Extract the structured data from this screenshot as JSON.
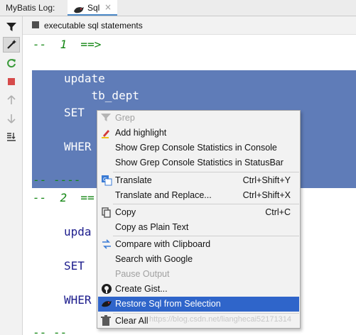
{
  "tool_window": {
    "title": "MyBatis Log:",
    "tab_label": "Sql",
    "tab_close": "×"
  },
  "console_header": {
    "label": "executable sql statements"
  },
  "console": {
    "lines": {
      "l1": "--  1  ==>",
      "l2": "update",
      "l3": "    tb_dept",
      "l4": "SET",
      "l5": "WHER",
      "l6": "-- ----",
      "l7": "--  2  ==",
      "l8": "upda",
      "l9": "SET",
      "l10": "WHER",
      "l11": "-- --"
    }
  },
  "context_menu": {
    "items": [
      {
        "label": "Grep",
        "shortcut": "",
        "icon": "filter-icon",
        "disabled": true
      },
      {
        "label": "Add highlight",
        "shortcut": "",
        "icon": "highlighter-icon",
        "disabled": false
      },
      {
        "label": "Show Grep Console Statistics in Console",
        "shortcut": "",
        "icon": "",
        "disabled": false
      },
      {
        "label": "Show Grep Console Statistics in StatusBar",
        "shortcut": "",
        "icon": "",
        "disabled": false
      },
      {
        "label": "Translate",
        "shortcut": "Ctrl+Shift+Y",
        "icon": "translate-icon",
        "disabled": false
      },
      {
        "label": "Translate and Replace...",
        "shortcut": "Ctrl+Shift+X",
        "icon": "",
        "disabled": false
      },
      {
        "label": "Copy",
        "shortcut": "Ctrl+C",
        "icon": "copy-icon",
        "disabled": false
      },
      {
        "label": "Copy as Plain Text",
        "shortcut": "",
        "icon": "",
        "disabled": false
      },
      {
        "label": "Compare with Clipboard",
        "shortcut": "",
        "icon": "compare-icon",
        "disabled": false
      },
      {
        "label": "Search with Google",
        "shortcut": "",
        "icon": "",
        "disabled": false
      },
      {
        "label": "Pause Output",
        "shortcut": "",
        "icon": "",
        "disabled": true
      },
      {
        "label": "Create Gist...",
        "shortcut": "",
        "icon": "github-icon",
        "disabled": false
      },
      {
        "label": "Restore Sql from Selection",
        "shortcut": "",
        "icon": "mybatis-bird-icon",
        "disabled": false,
        "highlighted": true
      },
      {
        "label": "Clear All",
        "shortcut": "",
        "icon": "trash-icon",
        "disabled": false
      }
    ]
  },
  "watermark": "https://blog.csdn.net/lianghecai52171314",
  "colors": {
    "selection": "#5f7cb8",
    "menu_highlight": "#2f65ca",
    "comment_green": "#138613",
    "keyword_navy": "#1c1c8c"
  }
}
